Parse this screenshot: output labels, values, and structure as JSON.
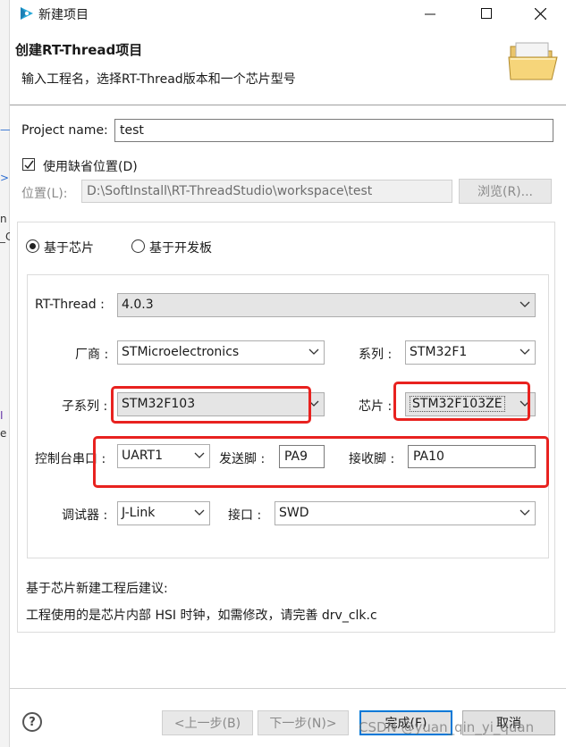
{
  "window": {
    "title": "新建项目",
    "minimize_glyph": "—",
    "maximize_glyph": "☐",
    "close_glyph": "✕"
  },
  "header": {
    "title": "创建RT-Thread项目",
    "description": "输入工程名，选择RT-Thread版本和一个芯片型号",
    "icon": "folder-icon"
  },
  "project": {
    "name_label": "Project name:",
    "name_value": "test",
    "use_default_label": "使用缺省位置(D)",
    "use_default_checked": true,
    "location_label": "位置(L):",
    "location_value": "D:\\SoftInstall\\RT-ThreadStudio\\workspace\\test",
    "browse_label": "浏览(R)..."
  },
  "mode": {
    "chip_label": "基于芯片",
    "board_label": "基于开发板",
    "selected": "chip"
  },
  "form": {
    "rtthread_label": "RT-Thread :",
    "rtthread_value": "4.0.3",
    "vendor_label": "厂商 :",
    "vendor_value": "STMicroelectronics",
    "series_label": "系列 :",
    "series_value": "STM32F1",
    "subseries_label": "子系列 :",
    "subseries_value": "STM32F103",
    "chip_label": "芯片 :",
    "chip_value": "STM32F103ZE",
    "console_label": "控制台串口 :",
    "console_value": "UART1",
    "tx_label": "发送脚 :",
    "tx_value": "PA9",
    "rx_label": "接收脚 :",
    "rx_value": "PA10",
    "debugger_label": "调试器 :",
    "debugger_value": "J-Link",
    "interface_label": "接口 :",
    "interface_value": "SWD"
  },
  "advice": {
    "line1": "基于芯片新建工程后建议:",
    "line2": "工程使用的是芯片内部 HSI 时钟，如需修改，请完善 drv_clk.c"
  },
  "footer": {
    "help_glyph": "?",
    "back_label": "<上一步(B)",
    "next_label": "下一步(N)>",
    "finish_label": "完成(F)",
    "cancel_label": "取消"
  },
  "watermark": "CSDN @yuan_qin_yi_quan",
  "colors": {
    "highlight_box": "#e8221f",
    "default_button_border": "#0078d7"
  }
}
